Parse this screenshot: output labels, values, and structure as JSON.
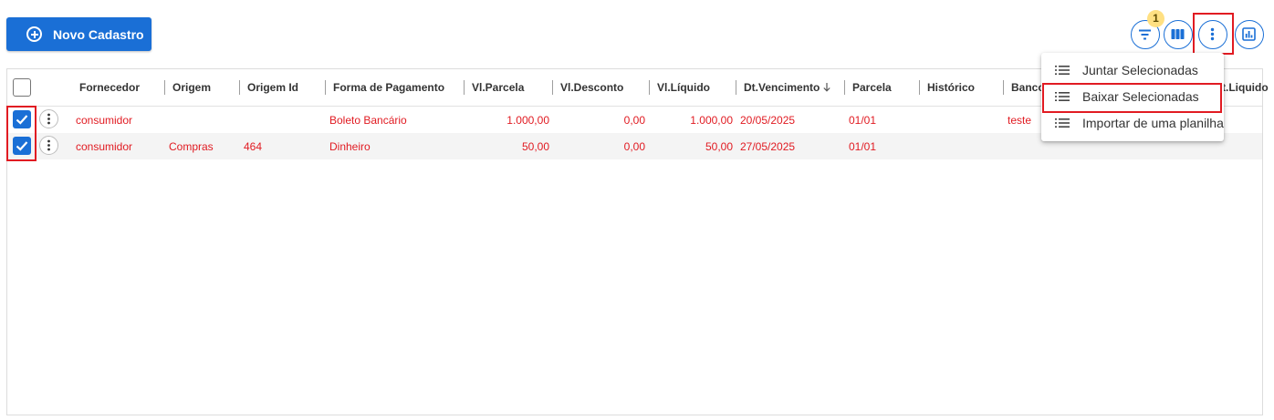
{
  "toolbar": {
    "new_button_label": "Novo Cadastro",
    "filter_badge_count": "1"
  },
  "grid": {
    "columns": [
      {
        "key": "fornecedor",
        "label": "Fornecedor"
      },
      {
        "key": "origem",
        "label": "Origem"
      },
      {
        "key": "origem_id",
        "label": "Origem Id"
      },
      {
        "key": "forma_pagamento",
        "label": "Forma de Pagamento"
      },
      {
        "key": "vl_parcela",
        "label": "Vl.Parcela"
      },
      {
        "key": "vl_desconto",
        "label": "Vl.Desconto"
      },
      {
        "key": "vl_liquido",
        "label": "Vl.Líquido"
      },
      {
        "key": "dt_vencimento",
        "label": "Dt.Vencimento",
        "sort": "desc"
      },
      {
        "key": "parcela",
        "label": "Parcela"
      },
      {
        "key": "historico",
        "label": "Histórico"
      },
      {
        "key": "banco",
        "label": "Banco"
      },
      {
        "key": "dt_liquido",
        "label": "t.Liquido"
      }
    ],
    "rows": [
      {
        "selected": true,
        "fornecedor": "consumidor",
        "origem": "",
        "origem_id": "",
        "forma_pagamento": "Boleto Bancário",
        "vl_parcela": "1.000,00",
        "vl_desconto": "0,00",
        "vl_liquido": "1.000,00",
        "dt_vencimento": "20/05/2025",
        "parcela": "01/01",
        "historico": "",
        "banco": "teste"
      },
      {
        "selected": true,
        "fornecedor": "consumidor",
        "origem": "Compras",
        "origem_id": "464",
        "forma_pagamento": "Dinheiro",
        "vl_parcela": "50,00",
        "vl_desconto": "0,00",
        "vl_liquido": "50,00",
        "dt_vencimento": "27/05/2025",
        "parcela": "01/01",
        "historico": "",
        "banco": ""
      }
    ]
  },
  "menu": {
    "items": [
      {
        "label": "Juntar Selecionadas",
        "icon": "list-icon"
      },
      {
        "label": "Baixar Selecionadas",
        "icon": "list-icon",
        "highlighted": true
      },
      {
        "label": "Importar de uma planilha",
        "icon": "list-icon"
      }
    ]
  },
  "colors": {
    "primary": "#1a6fd6",
    "row_text": "#e11b22",
    "highlight_border": "#e11b22",
    "badge": "#ffe082"
  }
}
